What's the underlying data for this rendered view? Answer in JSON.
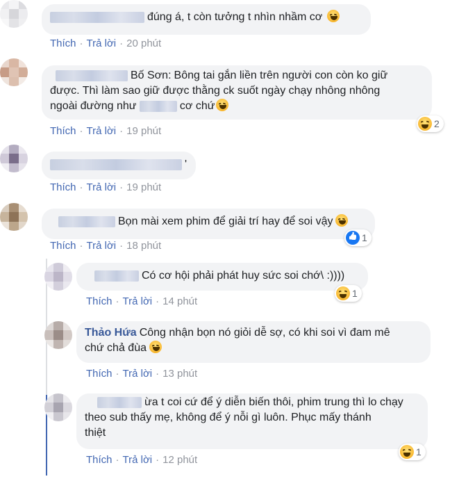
{
  "comments": [
    {
      "text": "đúng á, t còn tưởng t nhìn nhầm cơ",
      "emoji_icon": "smiling-face-icon",
      "actions": {
        "like": "Thích",
        "reply": "Trả lời",
        "time": "20 phút"
      }
    },
    {
      "name": "Bố Sơn:",
      "text_line1": "Bông tai gắn liền trên người con còn ko giữ",
      "text_line2": "được. Thì làm sao giữ được thằng ck suốt ngày chạy nhông nhông",
      "text_line3_a": "ngoài đường như",
      "text_line3_b": "cơ chứ",
      "emoji_icon": "grinning-face-icon",
      "actions": {
        "like": "Thích",
        "reply": "Trả lời",
        "time": "19 phút"
      },
      "reaction_count": "2",
      "reaction_icon": "haha-icon"
    },
    {
      "text": "'",
      "actions": {
        "like": "Thích",
        "reply": "Trả lời",
        "time": "19 phút"
      }
    },
    {
      "text": "Bọn mài xem phim để giải trí hay để soi vậy",
      "emoji_icon": "laughing-face-icon",
      "actions": {
        "like": "Thích",
        "reply": "Trả lời",
        "time": "18 phút"
      },
      "reaction_count": "1",
      "reaction_icon": "like-icon"
    }
  ],
  "replies": [
    {
      "text": "Có cơ hội phải phát huy sức soi chớ\\ :))))",
      "actions": {
        "like": "Thích",
        "reply": "Trả lời",
        "time": "14 phút"
      },
      "reaction_count": "1",
      "reaction_icon": "haha-icon"
    },
    {
      "name": "Thảo Hứa",
      "text_line1": "Công nhận bọn nó giỏi dễ sợ, có khi soi vì đam mê",
      "text_line2": "chứ chả đùa",
      "emoji_icon": "laughing-face-icon",
      "actions": {
        "like": "Thích",
        "reply": "Trả lời",
        "time": "13 phút"
      }
    },
    {
      "text_line1": "ừa t coi cứ để ý diễn biến thôi, phim trung thì lo chạy",
      "text_line2": "theo sub thấy mẹ, không để ý nỗi gì luôn. Phục mấy thánh",
      "text_line3": "thiệt",
      "actions": {
        "like": "Thích",
        "reply": "Trả lời",
        "time": "12 phút"
      },
      "reaction_count": "1",
      "reaction_icon": "haha-icon"
    }
  ],
  "colors": {
    "bubble": "#f2f3f5",
    "link": "#4267b2",
    "name": "#385898",
    "muted": "#90949c"
  }
}
